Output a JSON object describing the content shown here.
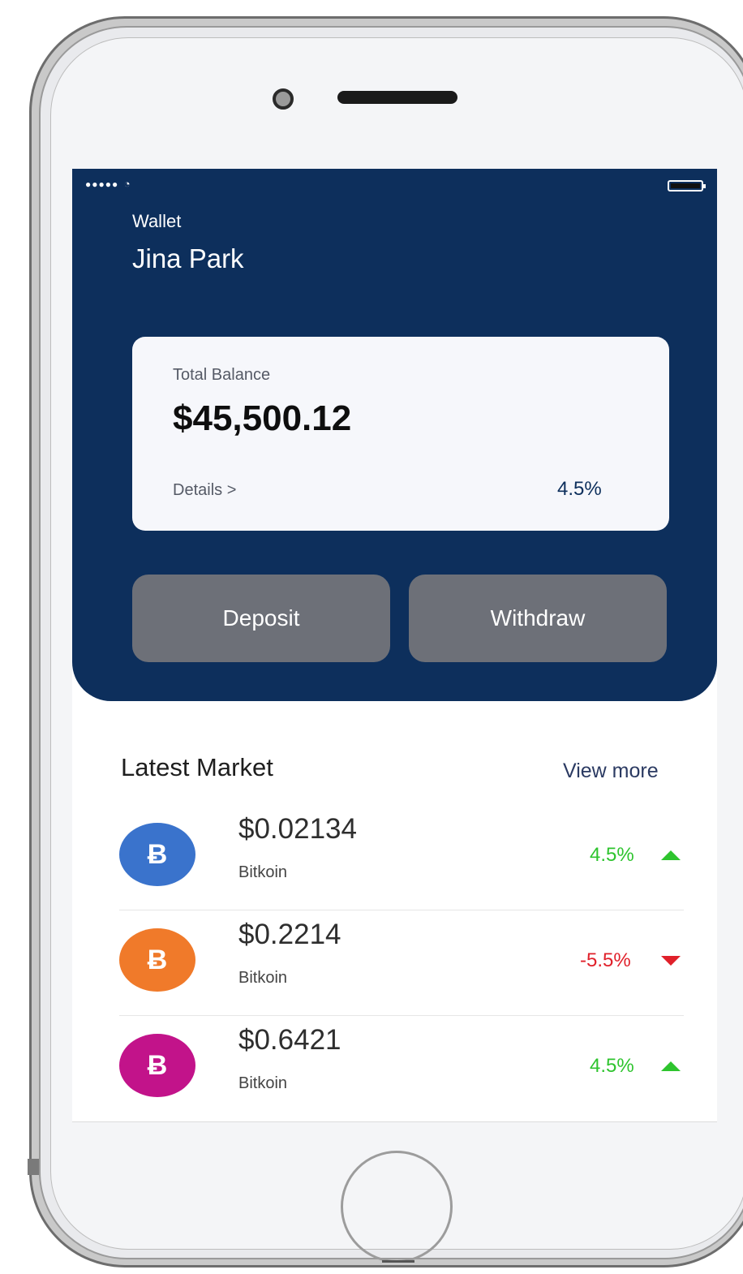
{
  "wallet": {
    "label": "Wallet",
    "user_name": "Jina Park"
  },
  "balance": {
    "label": "Total Balance",
    "value": "$45,500.12",
    "details_link": "Details >",
    "change": "4.5%"
  },
  "actions": {
    "deposit_label": "Deposit",
    "withdraw_label": "Withdraw"
  },
  "market": {
    "title": "Latest Market",
    "view_more": "View more",
    "items": [
      {
        "icon": "bitcoin-icon",
        "symbol": "Ƀ",
        "price": "$0.02134",
        "name": "Bitkoin",
        "change": "4.5%",
        "trend": "up",
        "color": "#3a73cc"
      },
      {
        "icon": "bitcoin-icon",
        "symbol": "Ƀ",
        "price": "$0.2214",
        "name": "Bitkoin",
        "change": "-5.5%",
        "trend": "down",
        "color": "#f07a2a"
      },
      {
        "icon": "bitcoin-icon",
        "symbol": "Ƀ",
        "price": "$0.6421",
        "name": "Bitkoin",
        "change": "4.5%",
        "trend": "up",
        "color": "#c2138a"
      }
    ]
  },
  "colors": {
    "header_bg": "#0d2f5c",
    "positive": "#2ec42e",
    "negative": "#e0202a",
    "button_bg": "#6d7078"
  }
}
